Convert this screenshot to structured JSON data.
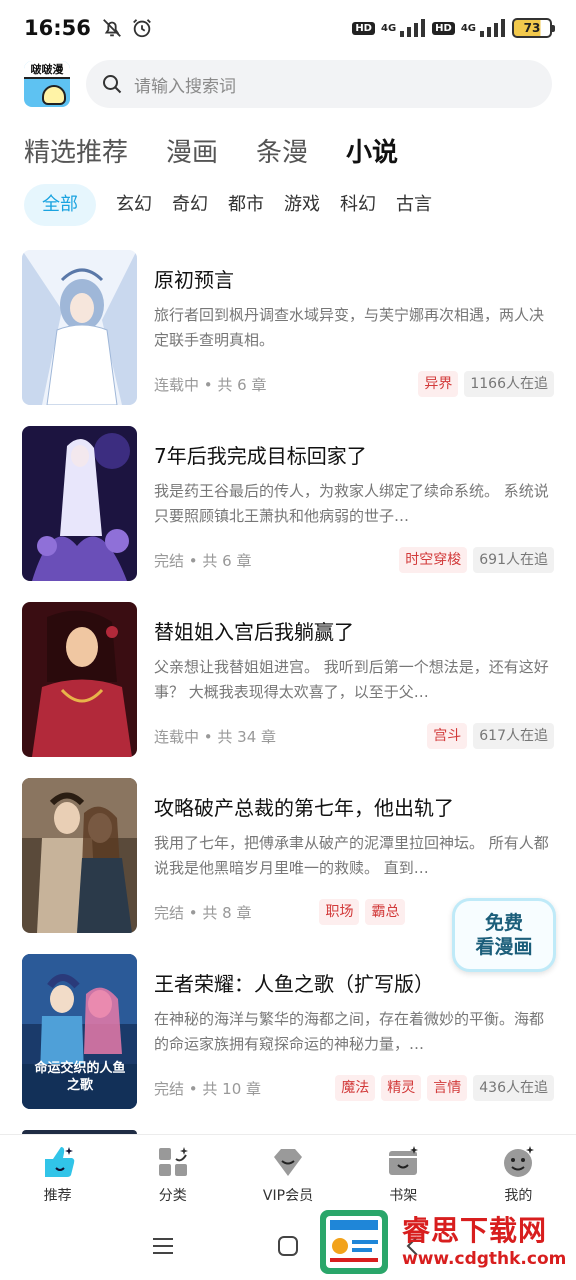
{
  "status_bar": {
    "time": "16:56",
    "hd1": "HD",
    "net1": "4G",
    "hd2": "HD",
    "net2": "4G",
    "battery": "73",
    "icons": [
      "mute-bell-icon",
      "alarm-icon",
      "signal-icon",
      "battery-icon"
    ]
  },
  "search": {
    "placeholder": "请输入搜索词",
    "logo_text": "啵啵漫"
  },
  "primary_tabs": [
    "精选推荐",
    "漫画",
    "条漫",
    "小说"
  ],
  "primary_tab_active": "小说",
  "genres": [
    "全部",
    "玄幻",
    "奇幻",
    "都市",
    "游戏",
    "科幻",
    "古言"
  ],
  "genre_active": "全部",
  "books": [
    {
      "title": "原初预言",
      "desc": "旅行者回到枫丹调查水域异变，与芙宁娜再次相遇，两人决定联手查明真相。",
      "status": "连载中 • 共 6 章",
      "tags": [
        "异界"
      ],
      "readers": "1166人在追",
      "cover_colors": [
        "#eef3fb",
        "#9fb7d8",
        "#5a78a8"
      ]
    },
    {
      "title": "7年后我完成目标回家了",
      "desc": "我是药王谷最后的传人，为救家人绑定了续命系统。 系统说只要照顾镇北王萧执和他病弱的世子…",
      "status": "完结 • 共 6 章",
      "tags": [
        "时空穿梭"
      ],
      "readers": "691人在追",
      "cover_colors": [
        "#1c1440",
        "#6a4fb8",
        "#c9c3f0"
      ]
    },
    {
      "title": "替姐姐入宫后我躺赢了",
      "desc": "父亲想让我替姐姐进宫。 我听到后第一个想法是，还有这好事？ 大概我表现得太欢喜了，以至于父…",
      "status": "连载中 • 共 34 章",
      "tags": [
        "宫斗"
      ],
      "readers": "617人在追",
      "cover_colors": [
        "#3a0d12",
        "#b2293a",
        "#f0c7a2"
      ]
    },
    {
      "title": "攻略破产总裁的第七年，他出轨了",
      "desc": "我用了七年，把傅承聿从破产的泥潭里拉回神坛。 所有人都说我是他黑暗岁月里唯一的救赎。 直到…",
      "status": "完结 • 共 8 章",
      "tags": [
        "职场",
        "霸总"
      ],
      "readers": "",
      "cover_colors": [
        "#5a4a3a",
        "#c7b39a",
        "#2b3a4a"
      ]
    },
    {
      "title": "王者荣耀：人鱼之歌（扩写版）",
      "desc": "在神秘的海洋与繁华的海都之间，存在着微妙的平衡。海都的命运家族拥有窥探命运的神秘力量，…",
      "status": "完结 • 共 10 章",
      "tags": [
        "魔法",
        "精灵",
        "言情"
      ],
      "readers": "436人在追",
      "cover_colors": [
        "#1a3a6a",
        "#4fa0d8",
        "#e87aa8"
      ],
      "cover_text": "命运交织的人鱼之歌"
    }
  ],
  "free_badge": [
    "免费",
    "看漫画"
  ],
  "bottom_nav": [
    {
      "label": "推荐",
      "icon": "thumbs-up-icon"
    },
    {
      "label": "分类",
      "icon": "category-icon"
    },
    {
      "label": "VIP会员",
      "icon": "vip-diamond-icon"
    },
    {
      "label": "书架",
      "icon": "bookshelf-icon"
    },
    {
      "label": "我的",
      "icon": "profile-icon"
    }
  ],
  "watermark": {
    "title": "睿思下载网",
    "url": "www.cdgthk.com"
  },
  "colors": {
    "accent": "#1aa3e0",
    "tag_red": "#d23a3a",
    "tab_underline": "#7fd3f7"
  }
}
